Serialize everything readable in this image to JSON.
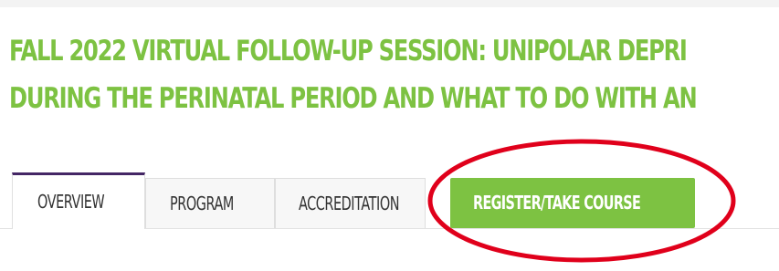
{
  "page": {
    "title_lines": [
      "FALL 2022 VIRTUAL FOLLOW-UP SESSION: UNIPOLAR DEPRI",
      "DURING THE PERINATAL PERIOD AND WHAT TO DO WITH AN"
    ]
  },
  "tabs": [
    {
      "label": "OVERVIEW",
      "active": true
    },
    {
      "label": "PROGRAM",
      "active": false
    },
    {
      "label": "ACCREDITATION",
      "active": false
    },
    {
      "label": "REGISTER/TAKE COURSE",
      "active": false,
      "highlighted": true
    }
  ],
  "colors": {
    "title": "#7dc242",
    "active_tab_border": "#442665",
    "tab_text": "#333333",
    "register_bg": "#7dc242",
    "register_text": "#ffffff",
    "annotation": "#e0001b"
  },
  "annotation": {
    "shape": "oval",
    "encloses": "register-take-course-tab"
  }
}
